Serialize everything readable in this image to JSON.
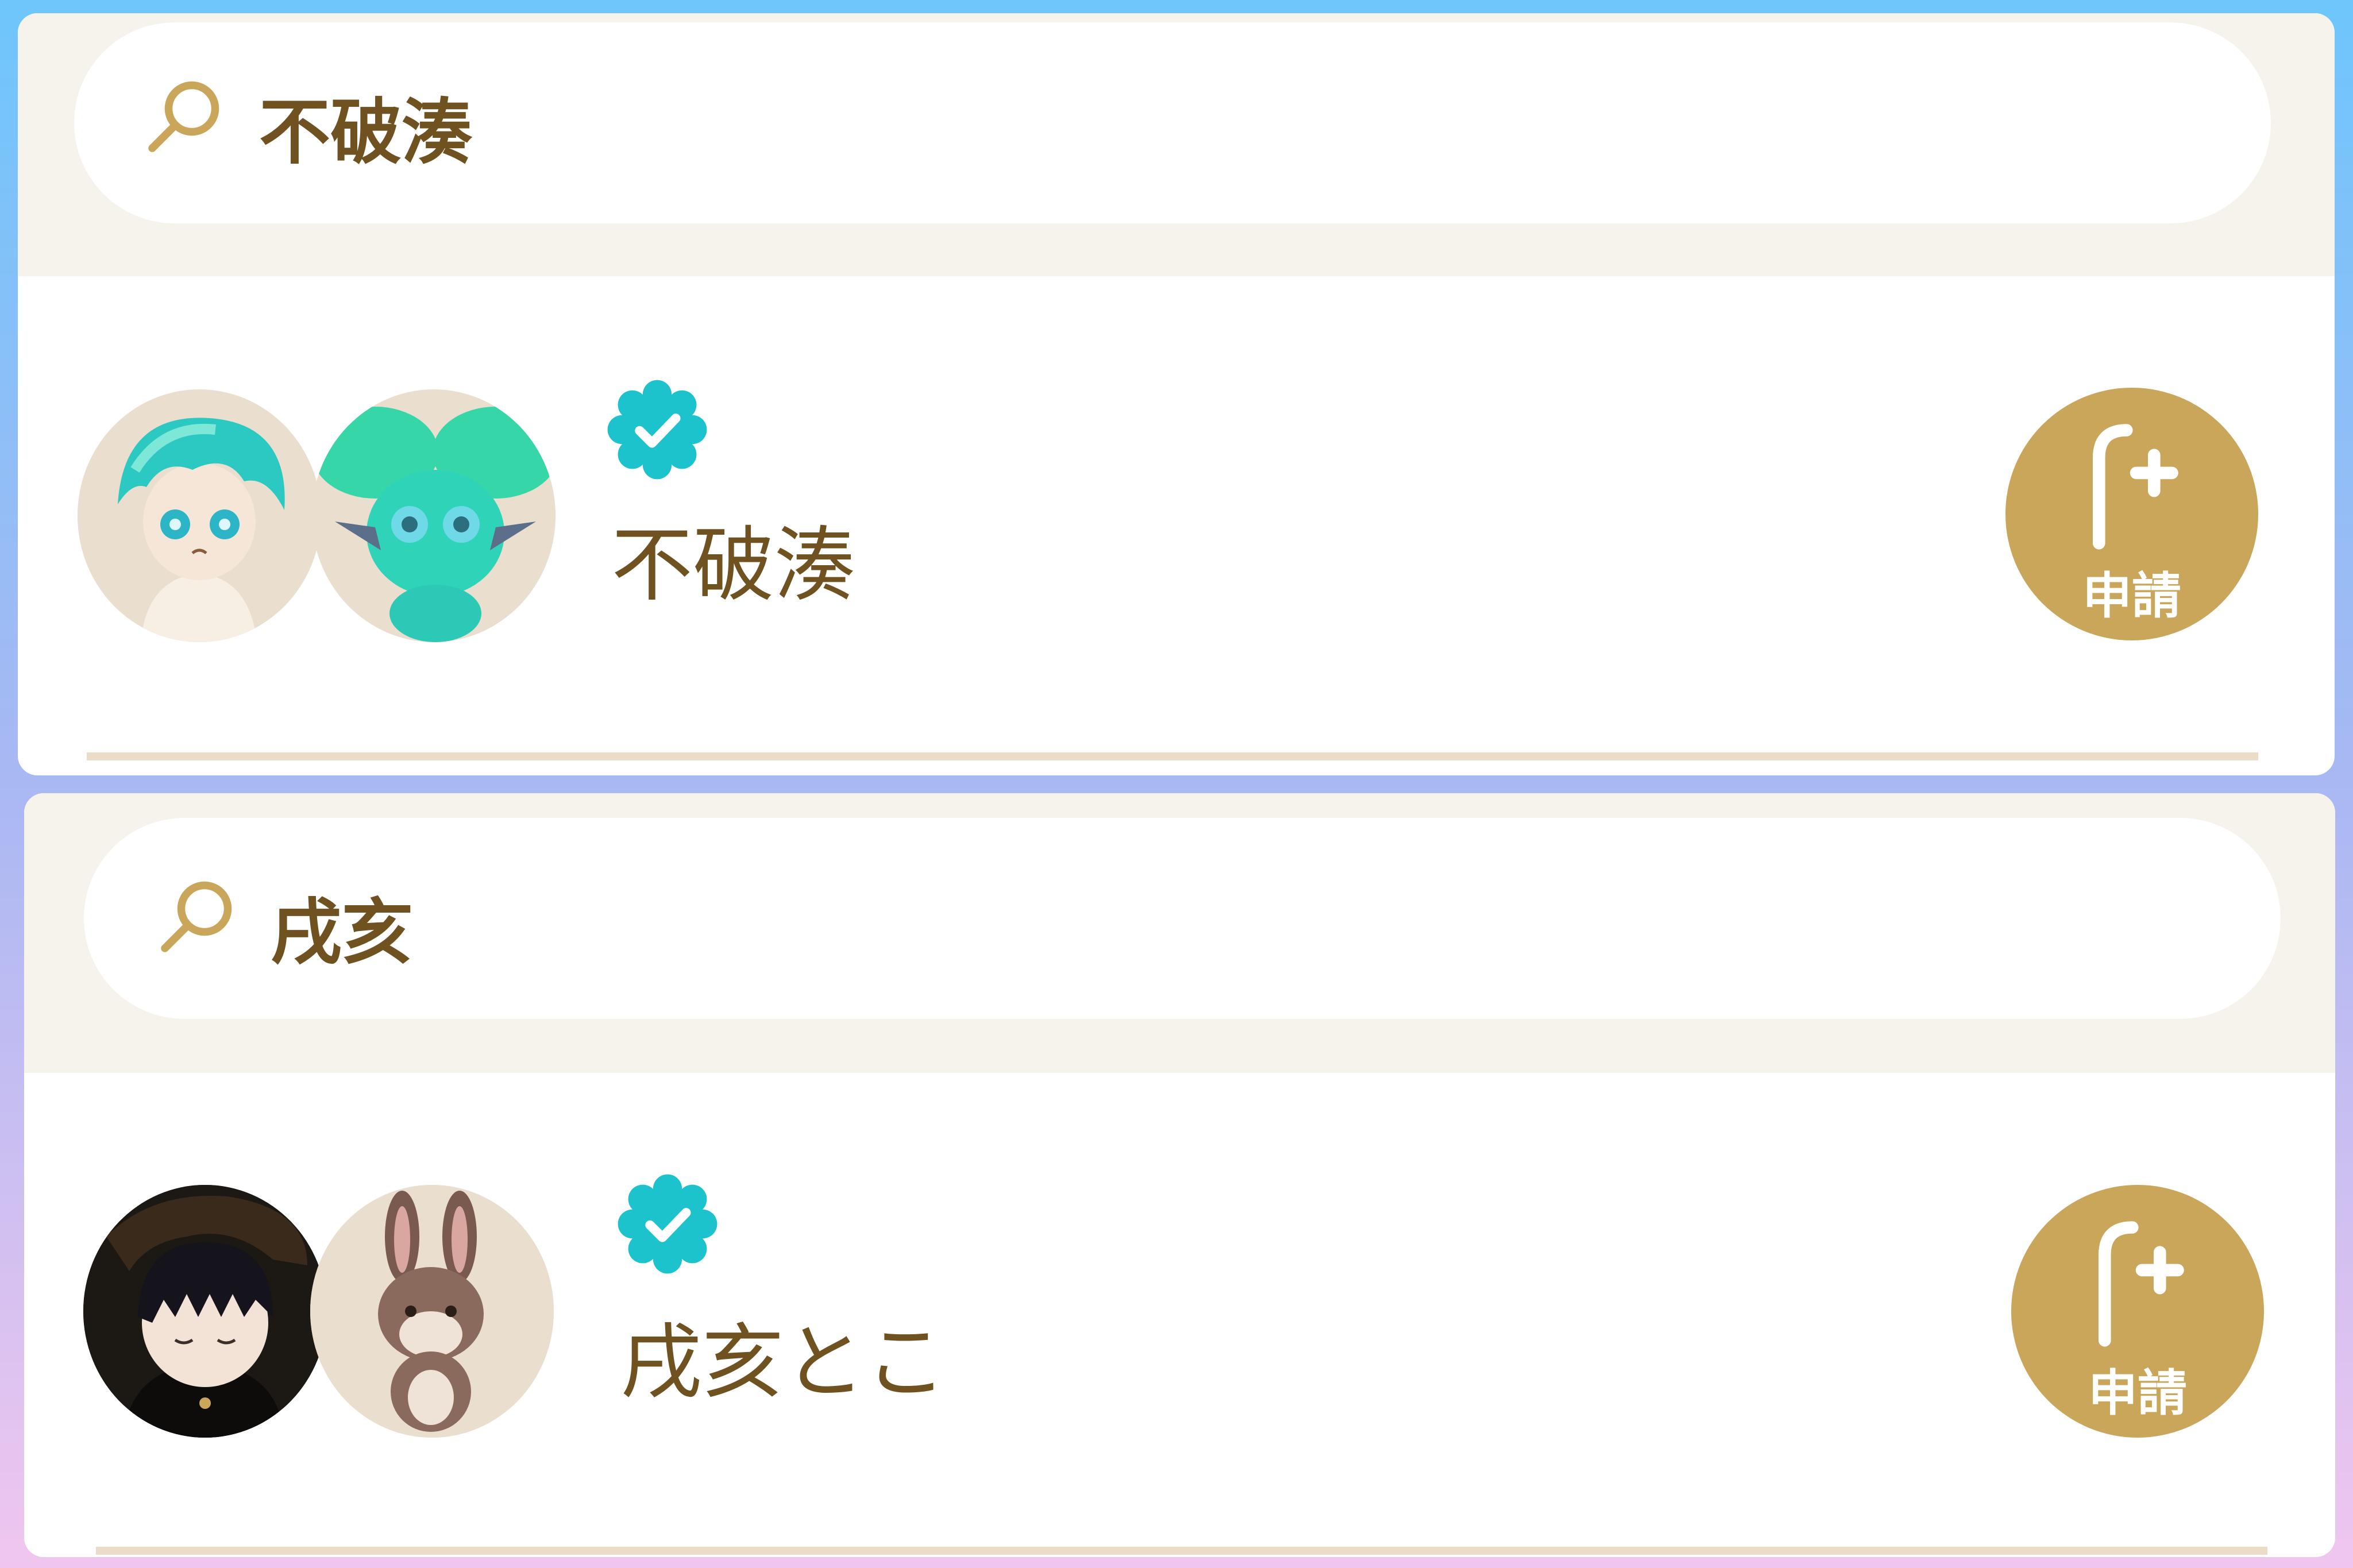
{
  "theme": {
    "accent": "#c9a65a",
    "text": "#6f5220",
    "verified": "#1cc2cc",
    "search_band": "#f6f3ec",
    "divider": "#eadcc7"
  },
  "results": [
    {
      "search": {
        "query": "不破湊",
        "icon": "search-icon"
      },
      "user": {
        "name": "不破湊",
        "verified_icon": "verified-badge-icon",
        "avatars": [
          "teal-haired-character-avatar",
          "teal-creature-avatar"
        ]
      },
      "action": {
        "label": "申請",
        "icon": "friend-plus-icon"
      }
    },
    {
      "search": {
        "query": "戌亥",
        "icon": "search-icon"
      },
      "user": {
        "name": "戌亥とこ",
        "verified_icon": "verified-badge-icon",
        "avatars": [
          "dark-haired-character-avatar",
          "brown-rabbit-avatar"
        ]
      },
      "action": {
        "label": "申請",
        "icon": "friend-plus-icon"
      }
    }
  ]
}
